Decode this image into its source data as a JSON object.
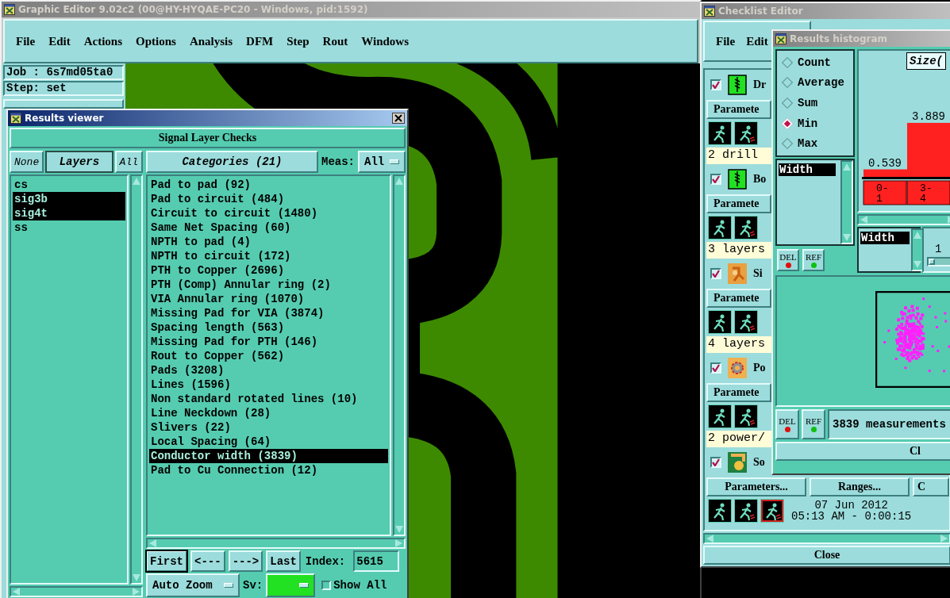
{
  "main_window": {
    "title": "Graphic Editor 9.02c2 (00@HY-HYQAE-PC20 - Windows, pid:1592)",
    "menu": [
      "File",
      "Edit",
      "Actions",
      "Options",
      "Analysis",
      "DFM",
      "Step",
      "Rout",
      "Windows"
    ],
    "job": "Job : 6s7md05ta0",
    "step": "Step: set"
  },
  "results_viewer": {
    "title": "Results viewer",
    "header": "Signal Layer Checks",
    "layers": {
      "none": "None",
      "title": "Layers",
      "all": "All",
      "items": [
        {
          "label": "cs",
          "selected": false
        },
        {
          "label": "sig3b",
          "selected": true
        },
        {
          "label": "sig4t",
          "selected": true
        },
        {
          "label": "ss",
          "selected": false
        }
      ]
    },
    "categories": {
      "title": "Categories (21)",
      "meas_label": "Meas:",
      "meas_value": "All",
      "items": [
        {
          "label": "Pad to pad (92)",
          "selected": false
        },
        {
          "label": "Pad to circuit (484)",
          "selected": false
        },
        {
          "label": "Circuit to circuit (1480)",
          "selected": false
        },
        {
          "label": "Same Net Spacing (60)",
          "selected": false
        },
        {
          "label": "NPTH to pad (4)",
          "selected": false
        },
        {
          "label": "NPTH to circuit (172)",
          "selected": false
        },
        {
          "label": "PTH to Copper (2696)",
          "selected": false
        },
        {
          "label": "PTH (Comp) Annular ring (2)",
          "selected": false
        },
        {
          "label": "VIA Annular ring (1070)",
          "selected": false
        },
        {
          "label": "Missing Pad for VIA (3874)",
          "selected": false
        },
        {
          "label": "Spacing length (563)",
          "selected": false
        },
        {
          "label": "Missing Pad for PTH (146)",
          "selected": false
        },
        {
          "label": "Rout to Copper (562)",
          "selected": false
        },
        {
          "label": "Pads (3208)",
          "selected": false
        },
        {
          "label": "Lines (1596)",
          "selected": false
        },
        {
          "label": "Non standard rotated lines (10)",
          "selected": false
        },
        {
          "label": "Line Neckdown (28)",
          "selected": false
        },
        {
          "label": "Slivers (22)",
          "selected": false
        },
        {
          "label": "Local Spacing (64)",
          "selected": false
        },
        {
          "label": "Conductor width (3839)",
          "selected": true
        },
        {
          "label": "Pad to Cu Connection (12)",
          "selected": false
        }
      ]
    },
    "nav": [
      "First",
      "<---",
      "--->",
      "Last"
    ],
    "index_label": "Index:",
    "index_value": "5615",
    "auto_zoom": "Auto Zoom",
    "sv_label": "Sv:",
    "show_all": {
      "label": "Show All",
      "checked": false
    }
  },
  "checklist_editor": {
    "title": "Checklist Editor",
    "menu": [
      "File",
      "Edit"
    ],
    "checks": [
      {
        "checked": true,
        "kind": "drill",
        "name": "Dr",
        "parameters": "Paramete",
        "summary": "2 drill"
      },
      {
        "checked": true,
        "kind": "drill",
        "name": "Bo",
        "parameters": "Paramete",
        "summary": "3 layers"
      },
      {
        "checked": true,
        "kind": "signal",
        "name": "Si",
        "parameters": "Paramete",
        "summary": "4 layers"
      },
      {
        "checked": true,
        "kind": "power",
        "name": "Po",
        "parameters": "Paramete",
        "summary": "2 power/"
      },
      {
        "checked": true,
        "kind": "solder",
        "name": "So",
        "buttons": [
          "Parameters...",
          "Ranges...",
          "C"
        ],
        "date": "07 Jun 2012",
        "time": "05:13 AM - 0:00:15"
      }
    ],
    "close": "Close"
  },
  "histogram": {
    "title": "Results histogram",
    "modes": [
      {
        "label": "Count",
        "selected": false
      },
      {
        "label": "Average",
        "selected": false
      },
      {
        "label": "Sum",
        "selected": false
      },
      {
        "label": "Min",
        "selected": true
      },
      {
        "label": "Max",
        "selected": false
      }
    ],
    "list": [
      {
        "label": "Width",
        "selected": true
      }
    ],
    "del": "DEL",
    "ref": "REF",
    "size_label": "Size(",
    "chart_data": {
      "type": "bar",
      "categories": [
        "0- 1",
        "3- 4"
      ],
      "values": [
        0.539,
        3.889
      ],
      "data_labels": true
    },
    "list2": [
      {
        "label": "Width",
        "selected": true
      }
    ],
    "slider_value": "1",
    "slider": {
      "level": 0.15
    },
    "del2": "DEL",
    "ref2": "REF",
    "measurements": "3839 measurements",
    "close": "Cl"
  }
}
